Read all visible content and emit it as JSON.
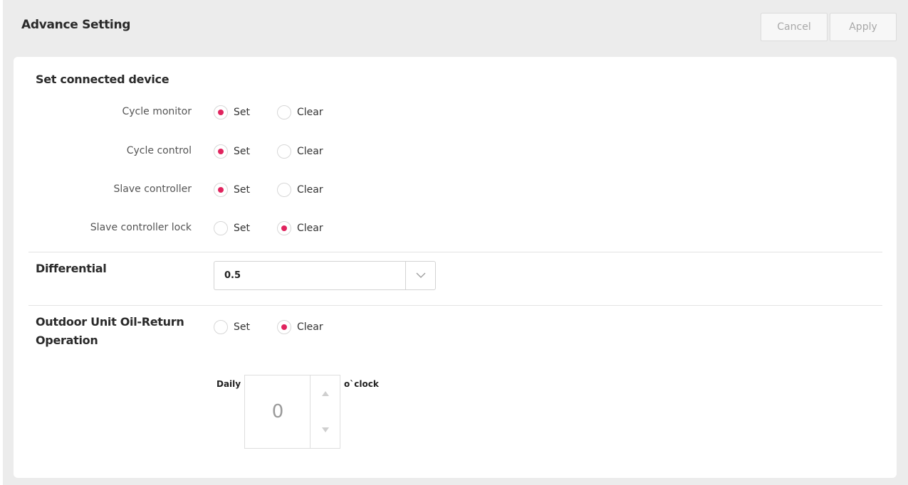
{
  "header": {
    "title": "Advance Setting",
    "cancel_label": "Cancel",
    "apply_label": "Apply"
  },
  "connected": {
    "title": "Set connected device",
    "rows": [
      {
        "label": "Cycle monitor",
        "set_label": "Set",
        "clear_label": "Clear",
        "selected": "Set"
      },
      {
        "label": "Cycle control",
        "set_label": "Set",
        "clear_label": "Clear",
        "selected": "Set"
      },
      {
        "label": "Slave controller",
        "set_label": "Set",
        "clear_label": "Clear",
        "selected": "Set"
      },
      {
        "label": "Slave controller lock",
        "set_label": "Set",
        "clear_label": "Clear",
        "selected": "Clear"
      }
    ]
  },
  "differential": {
    "title": "Differential",
    "value": "0.5"
  },
  "oil_return": {
    "title_line1": "Outdoor Unit Oil-Return",
    "title_line2": "Operation",
    "set_label": "Set",
    "clear_label": "Clear",
    "selected": "Clear",
    "daily_label": "Daily",
    "hour_value": "0",
    "oclock_label": "o`clock"
  },
  "colors": {
    "accent": "#e0245e",
    "background": "#ececec",
    "card": "#ffffff"
  },
  "icons": {
    "select_arrow": "chevron-down-icon",
    "step_up": "triangle-up-icon",
    "step_down": "triangle-down-icon"
  }
}
